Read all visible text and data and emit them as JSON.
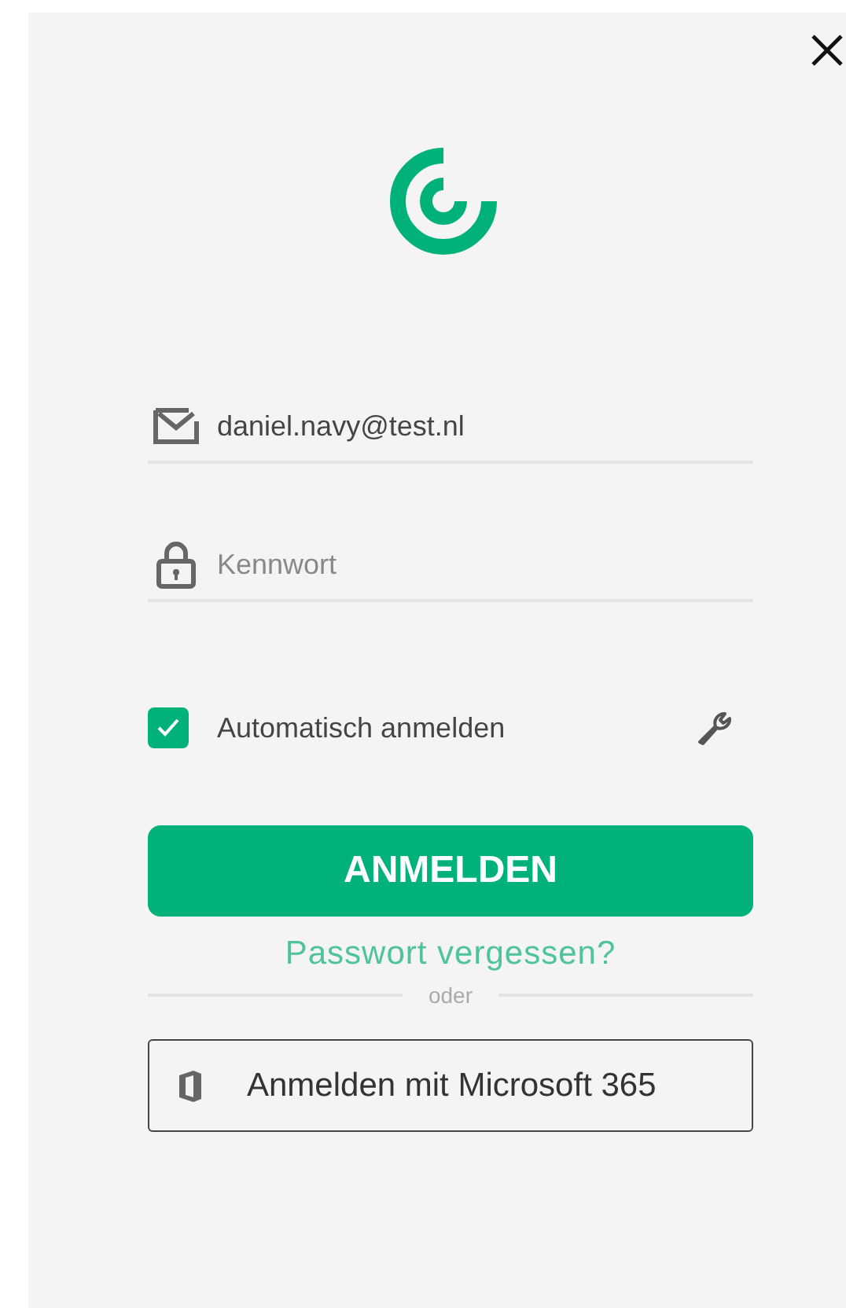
{
  "email": {
    "value": "daniel.navy@test.nl"
  },
  "password": {
    "placeholder": "Kennwort"
  },
  "auto_login": {
    "label": "Automatisch anmelden",
    "checked": true
  },
  "login_button": "ANMELDEN",
  "forgot_link": "Passwort vergessen?",
  "divider_text": "oder",
  "microsoft_button": "Anmelden mit Microsoft 365"
}
